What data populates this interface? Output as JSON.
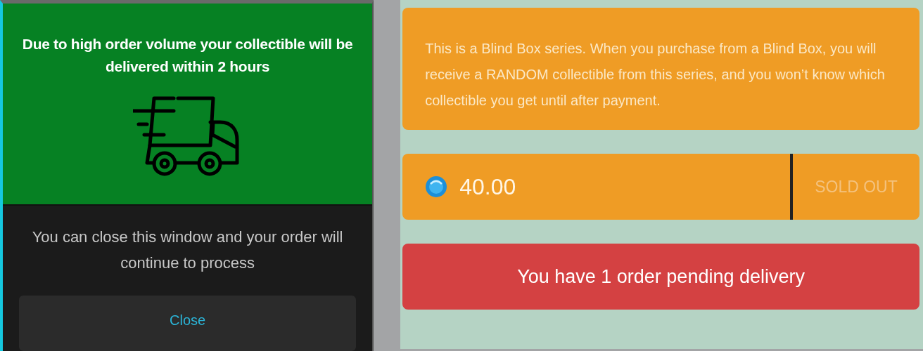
{
  "notice_dialog": {
    "title": "Due to high order volume your collectible will be delivered within 2 hours",
    "message": "You can close this window and your order will continue to process",
    "close_button": "Close"
  },
  "product": {
    "description": "This is a Blind Box series. When you purchase from a Blind Box, you will receive a RANDOM collectible from this series, and you won’t know which collectible you get until after payment.",
    "price": "40.00",
    "buy_button": {
      "label": "SOLD OUT",
      "disabled": true
    },
    "pending_banner": "You have 1 order pending delivery"
  }
}
